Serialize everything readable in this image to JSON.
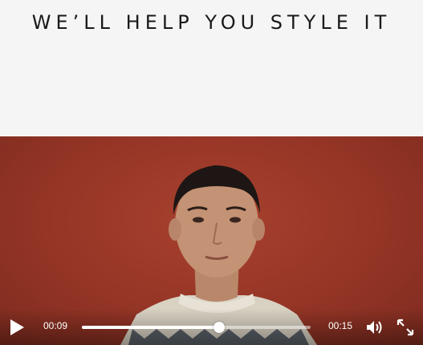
{
  "header": {
    "headline": "WE’LL HELP YOU STYLE IT"
  },
  "video": {
    "current_time": "00:09",
    "total_time": "00:15",
    "progress": 0.6,
    "background_color": "#953526",
    "controls": {
      "play_icon": "play-icon",
      "volume_icon": "volume-icon",
      "fullscreen_icon": "fullscreen-icon"
    }
  }
}
